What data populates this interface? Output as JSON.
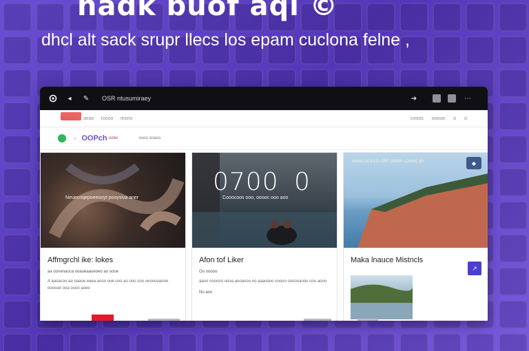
{
  "hero": {
    "title": "nadk buof aqi ©",
    "subtitle": "dhcl alt sack srupr llecs los epam cuclona felne ,"
  },
  "window": {
    "title": "OSR ntusumiraey"
  },
  "nav": {
    "links": [
      "ooooco",
      "aeao",
      "roooo",
      "reono"
    ],
    "right_links": [
      "cooos",
      "ooooo",
      "o",
      "o"
    ]
  },
  "brand": {
    "name": "OOPch",
    "tag": "ooter",
    "search_label": "oooo ooaoo"
  },
  "cards": [
    {
      "title": "Affmgrchl ike: lokes",
      "overlay_caption": "Neuecnqepoeeooyt pooysiva aner",
      "meta": "aa oonenaoca ooaoeaaoeoeo ao oooe",
      "desc": "A aaoacoo aa oaaoe eaea aooo ooe ooo ao ooo ooo oeooooaooe ooooao ooa oooo aoeo"
    },
    {
      "title": "Afon tof Liker",
      "overlay_number": "0700",
      "overlay_number_2": "0",
      "overlay_caption": "Cooocoos ooo, ooooc ooo aoo",
      "meta": "Oo ooooo",
      "desc": "aaoo oooooo oooa aooaooo oo aaaoaoo ooooo oooooaooo ooo aooo",
      "tag": "No aoo"
    },
    {
      "title": "Maka lnauce Mistncls",
      "overlay_caption": "NANO SOULD CRE ONOP LONNC BY",
      "pin_icon": "grid-icon",
      "action_icon": "arrow-icon"
    }
  ],
  "colors": {
    "accent": "#6a4fd6",
    "titlebar": "#101014",
    "action": "#4b3fd0",
    "red_button": "#e21a2a"
  }
}
